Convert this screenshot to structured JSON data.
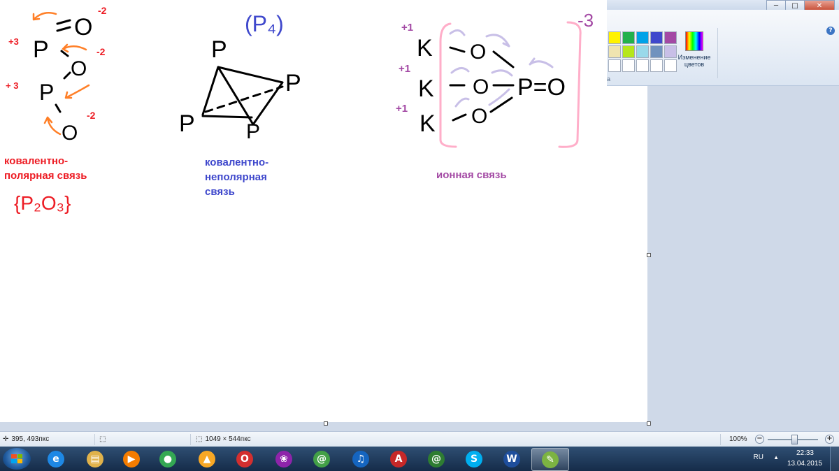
{
  "window": {
    "minimize_glyph": "─",
    "maximize_glyph": "□",
    "close_glyph": "✕",
    "help_glyph": "?"
  },
  "ribbon": {
    "palette": [
      "#fff200",
      "#22b14c",
      "#00a2e8",
      "#3f48cc",
      "#a349a4",
      "#efe4b0",
      "#b5e61d",
      "#99d9ea",
      "#7092be",
      "#c8bfe7",
      "#ffffff",
      "#ffffff",
      "#ffffff",
      "#ffffff",
      "#ffffff"
    ],
    "edit_colors_label": "Изменение цветов",
    "group_label_fragment": "а"
  },
  "drawing": {
    "left": {
      "charge_p1": "+3",
      "charge_p2": "+ 3",
      "charge_o1": "-2",
      "charge_o2": "-2",
      "charge_o3": "-2",
      "atom_p": "P",
      "atom_o": "O",
      "label_line1": "ковалентно-",
      "label_line2": "полярная связь",
      "formula": "{P₂O₃}"
    },
    "middle": {
      "formula": "(P₄)",
      "atom": "P",
      "label_line1": "ковалентно-",
      "label_line2": "неполярная",
      "label_line3": "связь"
    },
    "right": {
      "charge_k1": "+1",
      "charge_k2": "+1",
      "charge_k3": "+1",
      "atom_k": "K",
      "atom_o": "O",
      "center": "P=O",
      "bracket_charge": "-3",
      "label": "ионная связь"
    }
  },
  "statusbar": {
    "cursor_position": "395, 493пкс",
    "image_size": "1049 × 544пкс",
    "zoom_level": "100%"
  },
  "taskbar": {
    "buttons": [
      {
        "name": "internet-explorer",
        "glyph": "e",
        "color": "#1e88e5"
      },
      {
        "name": "file-explorer",
        "glyph": "▤",
        "color": "#e0b24b"
      },
      {
        "name": "media-player",
        "glyph": "▶",
        "color": "#f57c00"
      },
      {
        "name": "chrome",
        "glyph": "●",
        "color": "#34a853"
      },
      {
        "name": "aimp",
        "glyph": "▲",
        "color": "#f9a825"
      },
      {
        "name": "opera",
        "glyph": "O",
        "color": "#d32f2f"
      },
      {
        "name": "picasa",
        "glyph": "❀",
        "color": "#8e24aa"
      },
      {
        "name": "mail-agent",
        "glyph": "@",
        "color": "#43a047"
      },
      {
        "name": "media-center",
        "glyph": "♫",
        "color": "#1565c0"
      },
      {
        "name": "acrobat",
        "glyph": "A",
        "color": "#c62828"
      },
      {
        "name": "mail-agent-2",
        "glyph": "@",
        "color": "#2e7d32"
      },
      {
        "name": "skype",
        "glyph": "S",
        "color": "#00aff0"
      },
      {
        "name": "word",
        "glyph": "W",
        "color": "#1e4e9c"
      },
      {
        "name": "paint",
        "glyph": "✎",
        "color": "#7cb342"
      }
    ],
    "language": "RU",
    "time": "22:33",
    "date": "13.04.2015",
    "tray_arrow": "▲"
  }
}
